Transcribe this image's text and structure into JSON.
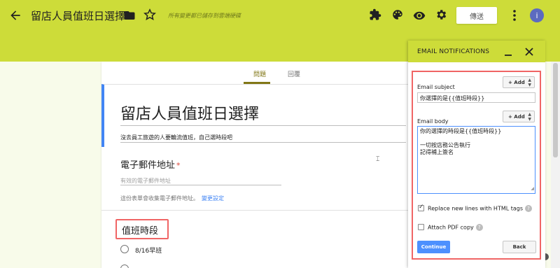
{
  "app_bar": {
    "form_title": "留店人員值班日選擇",
    "save_status": "所有變更都已儲存到雲端硬碟",
    "send_label": "傳送",
    "avatar_initial": "i",
    "background_color": "#cddc39"
  },
  "tabs": [
    {
      "label": "問題",
      "active": true
    },
    {
      "label": "回覆",
      "active": false
    }
  ],
  "form": {
    "title": "留店人員值班日選擇",
    "description": "沒去員工旅遊的人要輪流值班，自己選時段吧",
    "email_question": {
      "label": "電子郵件地址",
      "required_mark": "*",
      "placeholder": "有效的電子郵件地址",
      "note": "這份表單會收集電子郵件地址。",
      "change_settings_link": "變更設定"
    },
    "shift_question": {
      "title": "值班時段",
      "options": [
        "8/16早班"
      ]
    }
  },
  "email_panel": {
    "title": "EMAIL NOTIFICATIONS",
    "subject_label": "Email subject",
    "add_label": "+ Add",
    "subject_value": "你選擇的是{{值班時段}}",
    "body_label": "Email body",
    "body_lines": [
      "你的選擇的時段是{{值班時段}}",
      "",
      "一切按店務公告執行",
      "記得補上簽名"
    ],
    "replace_newlines_label": "Replace new lines with HTML tags",
    "replace_newlines_checked": true,
    "attach_pdf_label": "Attach PDF copy",
    "attach_pdf_checked": false,
    "continue_label": "Continue",
    "back_label": "Back",
    "help_glyph": "?"
  },
  "icons": {
    "back": "arrow-back-icon",
    "folder": "folder-icon",
    "star": "star-icon",
    "addon": "puzzle-icon",
    "palette": "palette-icon",
    "preview": "eye-icon",
    "settings": "gear-icon",
    "more": "more-vert-icon",
    "minimize": "minimize-icon",
    "close": "close-icon"
  },
  "colors": {
    "accent": "#cddc39",
    "tab_active": "#827717",
    "link": "#4285f4",
    "highlight_box": "#f06565",
    "continue_button": "#4d90fe"
  }
}
